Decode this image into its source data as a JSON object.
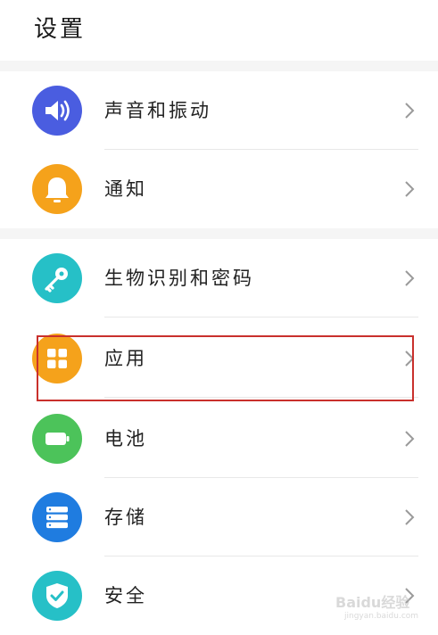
{
  "header": {
    "title": "设置"
  },
  "items": [
    {
      "label": "声音和振动",
      "icon": "speaker-icon",
      "color": "#4a5de0"
    },
    {
      "label": "通知",
      "icon": "bell-icon",
      "color": "#f5a21b"
    },
    {
      "label": "生物识别和密码",
      "icon": "key-icon",
      "color": "#26c0c7"
    },
    {
      "label": "应用",
      "icon": "apps-grid-icon",
      "color": "#f5a21b"
    },
    {
      "label": "电池",
      "icon": "battery-icon",
      "color": "#4cc35a"
    },
    {
      "label": "存储",
      "icon": "storage-icon",
      "color": "#1f7ce0"
    },
    {
      "label": "安全",
      "icon": "shield-check-icon",
      "color": "#26c0c7"
    }
  ],
  "highlighted_item": "应用",
  "watermark": {
    "text": "Baidu经验",
    "sub": "jingyan.baidu.com"
  }
}
